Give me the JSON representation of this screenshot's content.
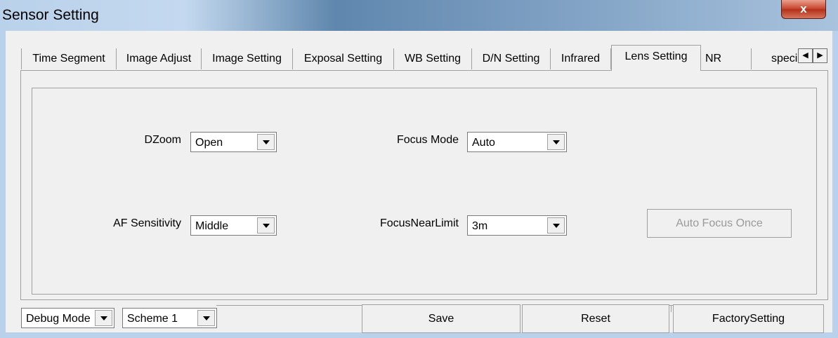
{
  "window": {
    "title": "Sensor Setting",
    "close_label": "x"
  },
  "tabs": [
    {
      "label": "Time Segment"
    },
    {
      "label": "Image Adjust"
    },
    {
      "label": "Image Setting"
    },
    {
      "label": "Exposal Setting"
    },
    {
      "label": "WB Setting"
    },
    {
      "label": "D/N Setting"
    },
    {
      "label": "Infrared"
    },
    {
      "label": "Lens Setting",
      "active": true
    },
    {
      "label": "NR"
    },
    {
      "label": "speci"
    }
  ],
  "tab_scroll": {
    "left": "◀",
    "right": "▶"
  },
  "lens": {
    "dzoom_label": "DZoom",
    "dzoom_value": "Open",
    "focus_mode_label": "Focus Mode",
    "focus_mode_value": "Auto",
    "af_sensitivity_label": "AF Sensitivity",
    "af_sensitivity_value": "Middle",
    "focus_near_limit_label": "FocusNearLimit",
    "focus_near_limit_value": "3m",
    "auto_focus_once_label": "Auto Focus Once"
  },
  "footer": {
    "mode_value": "Debug Mode",
    "scheme_value": "Scheme 1",
    "save_label": "Save",
    "reset_label": "Reset",
    "factory_label": "FactorySetting"
  }
}
